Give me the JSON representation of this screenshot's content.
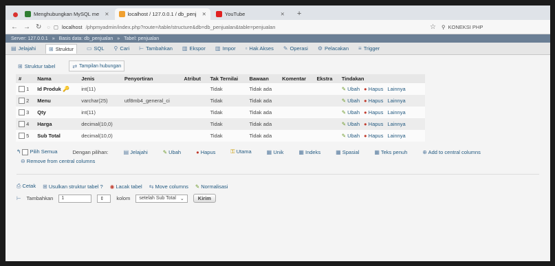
{
  "browser": {
    "tabs": [
      {
        "label": "Menghubungkan MySQL me",
        "fav": "#2e7d32",
        "active": false
      },
      {
        "label": "localhost / 127.0.0.1 / db_penj",
        "fav": "#f0a030",
        "active": true
      },
      {
        "label": "YouTube",
        "fav": "#e02020",
        "active": false
      }
    ],
    "url_host": "localhost",
    "url_path": "/phpmyadmin/index.php?route=/table/structure&db=db_penjualan&table=penjualan",
    "search_label": "KONEKSI PHP"
  },
  "breadcrumb": [
    "Server: 127.0.0.1",
    "Basis data: db_penjualan",
    "Tabel: penjualan"
  ],
  "pma_tabs": [
    {
      "label": "Jelajahi",
      "icon": "browse-icon"
    },
    {
      "label": "Struktur",
      "icon": "structure-icon",
      "active": true
    },
    {
      "label": "SQL",
      "icon": "sql-icon"
    },
    {
      "label": "Cari",
      "icon": "search-icon"
    },
    {
      "label": "Tambahkan",
      "icon": "insert-icon"
    },
    {
      "label": "Ekspor",
      "icon": "export-icon"
    },
    {
      "label": "Impor",
      "icon": "import-icon"
    },
    {
      "label": "Hak Akses",
      "icon": "privileges-icon"
    },
    {
      "label": "Operasi",
      "icon": "operations-icon"
    },
    {
      "label": "Pelacakan",
      "icon": "tracking-icon"
    },
    {
      "label": "Trigger",
      "icon": "trigger-icon"
    }
  ],
  "sub_tabs": {
    "structure": "Struktur tabel",
    "relations": "Tampilan hubungan"
  },
  "table": {
    "headers": [
      "#",
      "Nama",
      "Jenis",
      "Penyortiran",
      "Atribut",
      "Tak Ternilai",
      "Bawaan",
      "Komentar",
      "Ekstra",
      "Tindakan"
    ],
    "rows": [
      {
        "num": "1",
        "name": "Id Produk",
        "type": "int(11)",
        "collation": "",
        "null": "Tidak",
        "default": "Tidak ada",
        "key": true
      },
      {
        "num": "2",
        "name": "Menu",
        "type": "varchar(25)",
        "collation": "utf8mb4_general_ci",
        "null": "Tidak",
        "default": "Tidak ada",
        "key": false
      },
      {
        "num": "3",
        "name": "Qty",
        "type": "int(11)",
        "collation": "",
        "null": "Tidak",
        "default": "Tidak ada",
        "key": false
      },
      {
        "num": "4",
        "name": "Harga",
        "type": "decimal(10,0)",
        "collation": "",
        "null": "Tidak",
        "default": "Tidak ada",
        "key": false
      },
      {
        "num": "5",
        "name": "Sub Total",
        "type": "decimal(10,0)",
        "collation": "",
        "null": "Tidak",
        "default": "Tidak ada",
        "key": false
      }
    ],
    "actions": {
      "edit": "Ubah",
      "delete": "Hapus",
      "more": "Lainnya"
    }
  },
  "bulk": {
    "check_all": "Pilih Semua",
    "with_selected": "Dengan pilihan:",
    "browse": "Jelajahi",
    "edit": "Ubah",
    "delete": "Hapus",
    "primary": "Utama",
    "unique": "Unik",
    "index": "Indeks",
    "spatial": "Spasial",
    "fulltext": "Teks penuh",
    "add_central": "Add to central columns",
    "remove_central": "Remove from central columns"
  },
  "footer": {
    "print": "Cetak",
    "propose": "Usulkan struktur tabel",
    "track": "Lacak tabel",
    "move_columns": "Move columns",
    "normalize": "Normalisasi",
    "add": "Tambahkan",
    "add_count": "1",
    "column_label": "kolom",
    "position": "setelah Sub Total",
    "go": "Kirim"
  }
}
